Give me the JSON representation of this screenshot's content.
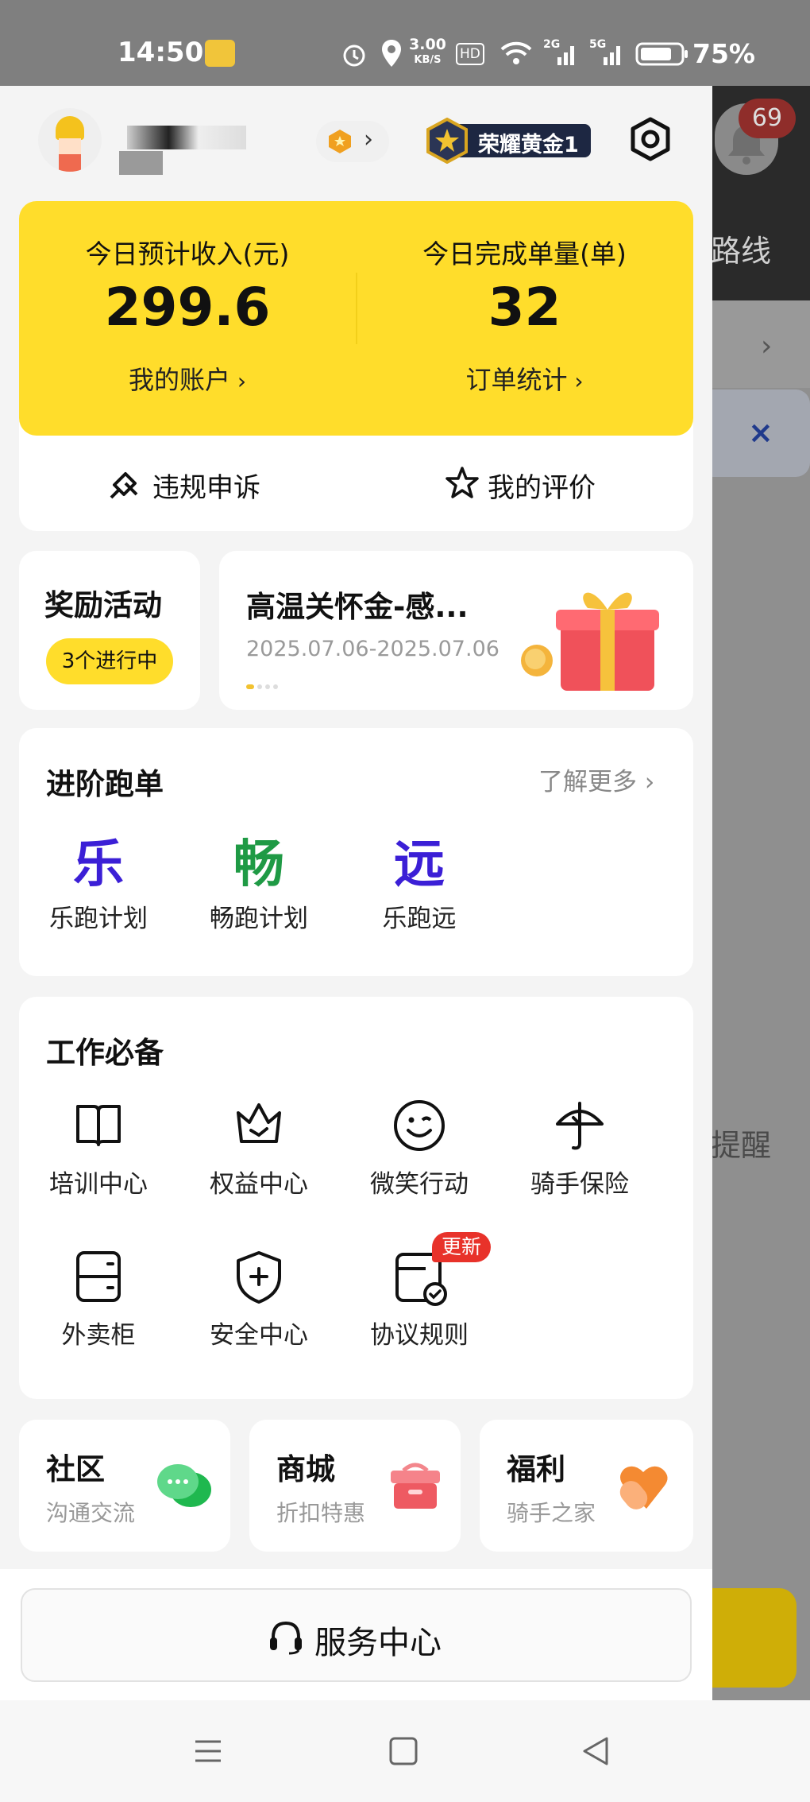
{
  "status_bar": {
    "time": "14:50",
    "net_speed_value": "3.00",
    "net_speed_unit": "KB/S",
    "hd_label": "HD",
    "sig1_label": "2G",
    "sig2_label": "5G",
    "battery": "75%"
  },
  "background_page": {
    "route_text": "路线",
    "reminder_text": "提醒",
    "notification_count": "69"
  },
  "profile": {
    "badge": "荣耀黄金1"
  },
  "earnings": {
    "income_label": "今日预计收入(元)",
    "income_value": "299.6",
    "account_link": "我的账户",
    "orders_label": "今日完成单量(单)",
    "orders_value": "32",
    "stats_link": "订单统计"
  },
  "actions": {
    "appeal": "违规申诉",
    "reviews": "我的评价"
  },
  "activities": {
    "title": "奖励活动",
    "ongoing": "3个进行中",
    "banner_title": "高温关怀金-感...",
    "banner_dates": "2025.07.06-2025.07.06"
  },
  "advanced": {
    "title": "进阶跑单",
    "more": "了解更多",
    "items": [
      {
        "glyph": "乐",
        "label": "乐跑计划",
        "color": "#3b1fd6"
      },
      {
        "glyph": "畅",
        "label": "畅跑计划",
        "color": "#1f9a45"
      },
      {
        "glyph": "远",
        "label": "乐跑远",
        "color": "#3b1fd6"
      }
    ]
  },
  "essentials": {
    "title": "工作必备",
    "items": [
      {
        "label": "培训中心",
        "icon": "book-icon"
      },
      {
        "label": "权益中心",
        "icon": "crown-icon"
      },
      {
        "label": "微笑行动",
        "icon": "smile-icon"
      },
      {
        "label": "骑手保险",
        "icon": "umbrella-icon"
      },
      {
        "label": "外卖柜",
        "icon": "locker-icon"
      },
      {
        "label": "安全中心",
        "icon": "shield-icon"
      },
      {
        "label": "协议规则",
        "icon": "agreement-icon"
      }
    ],
    "update_badge": "更新"
  },
  "bottom_cards": [
    {
      "title": "社区",
      "sub": "沟通交流"
    },
    {
      "title": "商城",
      "sub": "折扣特惠"
    },
    {
      "title": "福利",
      "sub": "骑手之家"
    }
  ],
  "service": {
    "label": "服务中心"
  },
  "colors": {
    "brand_yellow": "#FFDD2B",
    "badge_red": "#e8322a"
  }
}
